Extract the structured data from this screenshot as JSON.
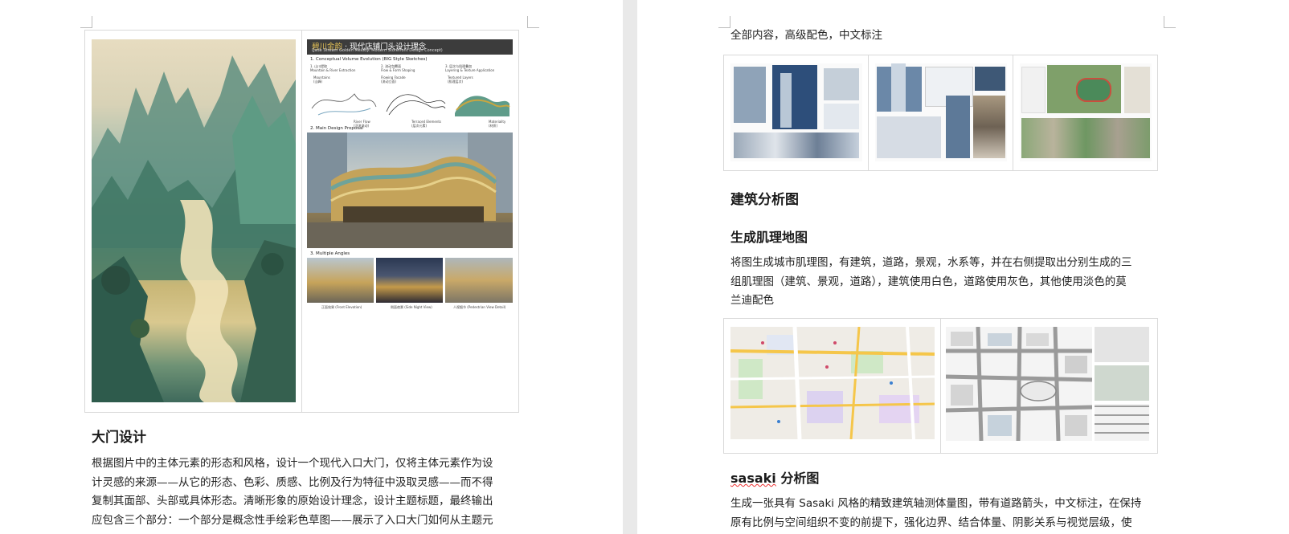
{
  "left_page": {
    "board": {
      "title_highlight": "碧川金韵",
      "title_rest": " · 现代店铺门头设计理念",
      "subtitle": "(Jade Stream Golden Melody: Modern Storefront Design Concept)",
      "section1": "1. Conceptual Volume Evolution (BIG Style Sketches)",
      "step1_title": "1. 山川提取",
      "step1_en": "Mountain & River Extraction",
      "step2_title": "2. 流动包覆面",
      "step2_en": "Flow & Form Shaping",
      "step3_title": "3. 层次与肌理叠加",
      "step3_en": "Layering & Texture Application",
      "label_mountains": "Mountains",
      "label_mountains_cn": "(山峰)",
      "label_flowing": "Flowing Facade",
      "label_flowing_cn": "(流动立面)",
      "label_textured": "Textured Layers",
      "label_textured_cn": "(肌理层次)",
      "label_river": "River Flow",
      "label_river_cn": "(河流流动)",
      "label_terraced": "Terraced Elements",
      "label_terraced_cn": "(层次元素)",
      "label_material": "Materiality",
      "label_material_cn": "(材质)",
      "section2": "2. Main Design Proposal",
      "section3": "3. Multiple Angles",
      "angle1": "正面效果 (Front Elevation)",
      "angle2": "侧面夜景 (Side Night View)",
      "angle3": "人视细节 (Pedestrian View Detail)"
    },
    "gate_heading": "大门设计",
    "gate_paragraph": [
      "根据图片中的主体元素的形态和风格，设计一个现代入口大门，仅将主体元素作为设",
      "计灵感的来源——从它的形态、色彩、质感、比例及行为特征中汲取灵感——而不得",
      "复制其面部、头部或具体形态。清晰形象的原始设计理念，设计主题标题，最终输出",
      "应包含三个部分：一个部分是概念性手绘彩色草图——展示了入口大门如何从主题元"
    ]
  },
  "right_page": {
    "top_line": "全部内容，高级配色，中文标注",
    "building_heading": "建筑分析图",
    "texture_heading": "生成肌理地图",
    "texture_paragraph": [
      "将图生成城市肌理图，有建筑，道路，景观，水系等，并在右侧提取出分别生成的三",
      "组肌理图（建筑、景观，道路），建筑使用白色，道路使用灰色，其他使用淡色的莫",
      "兰迪配色"
    ],
    "sasaki_heading_word": "sasaki",
    "sasaki_heading_rest": " 分析图",
    "sasaki_paragraph": [
      "生成一张具有 Sasaki 风格的精致建筑轴测体量图，带有道路箭头，中文标注，在保持",
      "原有比例与空间组织不变的前提下，强化边界、结合体量、阴影关系与视觉层级，使"
    ]
  },
  "colors": {
    "page_background": "#ffffff",
    "desk_background": "#e9e9e9",
    "board_header": "#3c3c3c",
    "gold_accent": "#e2bf55",
    "table_border": "#d9d9d9"
  }
}
